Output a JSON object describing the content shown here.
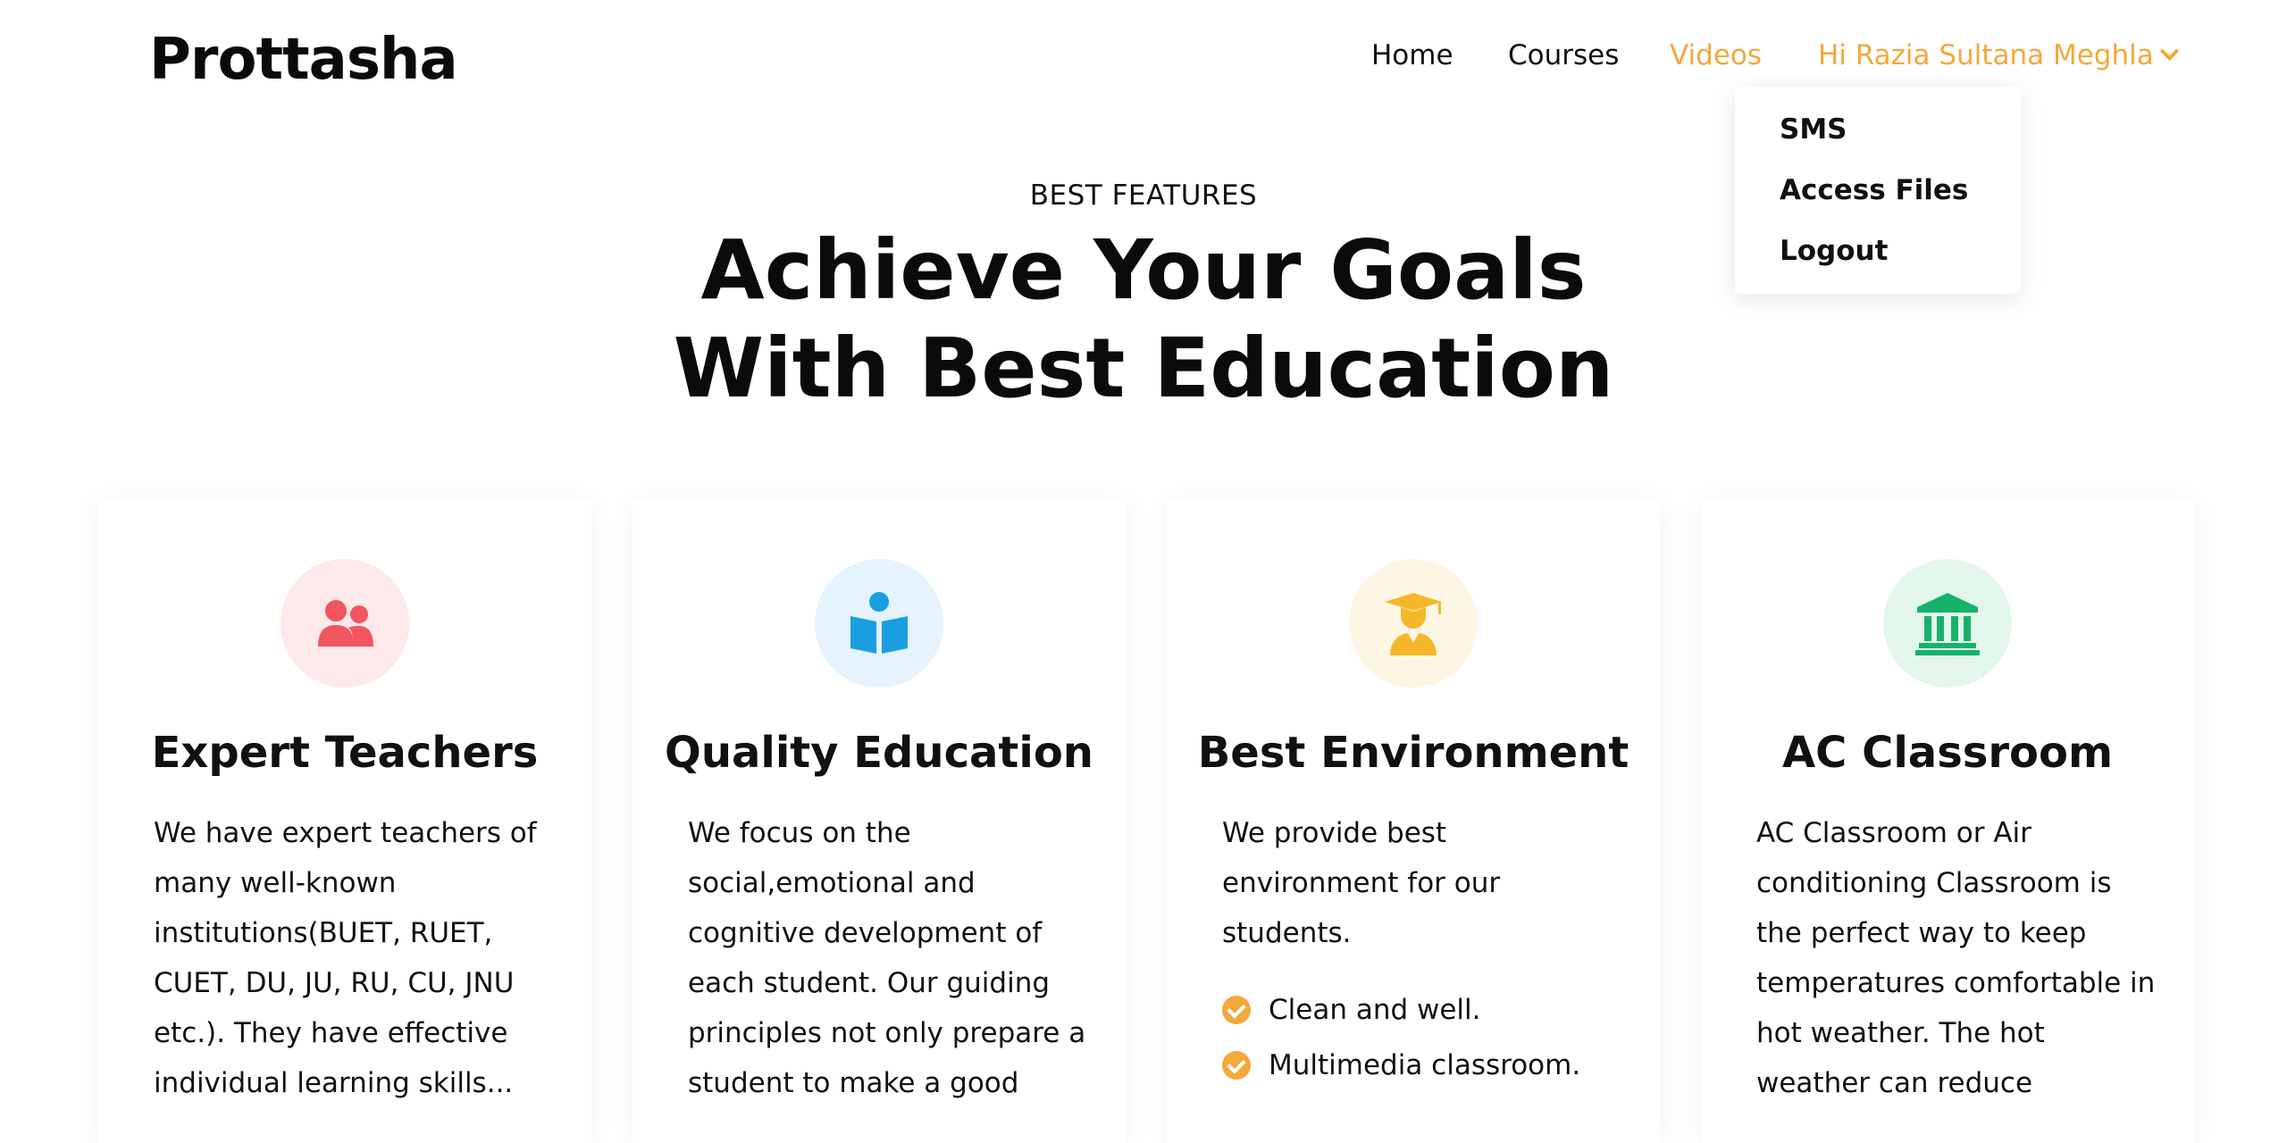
{
  "brand": "Prottasha",
  "nav": {
    "home": "Home",
    "courses": "Courses",
    "videos": "Videos",
    "user": "Hi Razia Sultana Meghla"
  },
  "dropdown": [
    "SMS",
    "Access Files",
    "Logout"
  ],
  "hero": {
    "eyebrow": "BEST FEATURES",
    "line1": "Achieve Your Goals",
    "line2": "With Best Education"
  },
  "colors": {
    "accent": "#f3a93b",
    "teachers": "#f2555f",
    "education": "#1a9ee0",
    "environment": "#f5b82b",
    "classroom": "#17b26a"
  },
  "cards": [
    {
      "icon": "users-icon",
      "title": "Expert Teachers",
      "text": "We have expert teachers of many well-known institutions(BUET, RUET, CUET, DU, JU, RU, CU, JNU etc.). They have effective individual learning skills..."
    },
    {
      "icon": "book-reader-icon",
      "title": "Quality Education",
      "text": "We focus on the social,emotional and cognitive development of each student. Our guiding principles not only prepare a student to make a good"
    },
    {
      "icon": "graduate-icon",
      "title": "Best Environment",
      "text": "We provide best environment for our students.",
      "list": [
        "Clean and well.",
        "Multimedia classroom."
      ]
    },
    {
      "icon": "institution-icon",
      "title": "AC Classroom",
      "text": "AC Classroom or Air conditioning Classroom is the perfect way to keep temperatures comfortable in hot weather. The hot weather can reduce"
    }
  ]
}
